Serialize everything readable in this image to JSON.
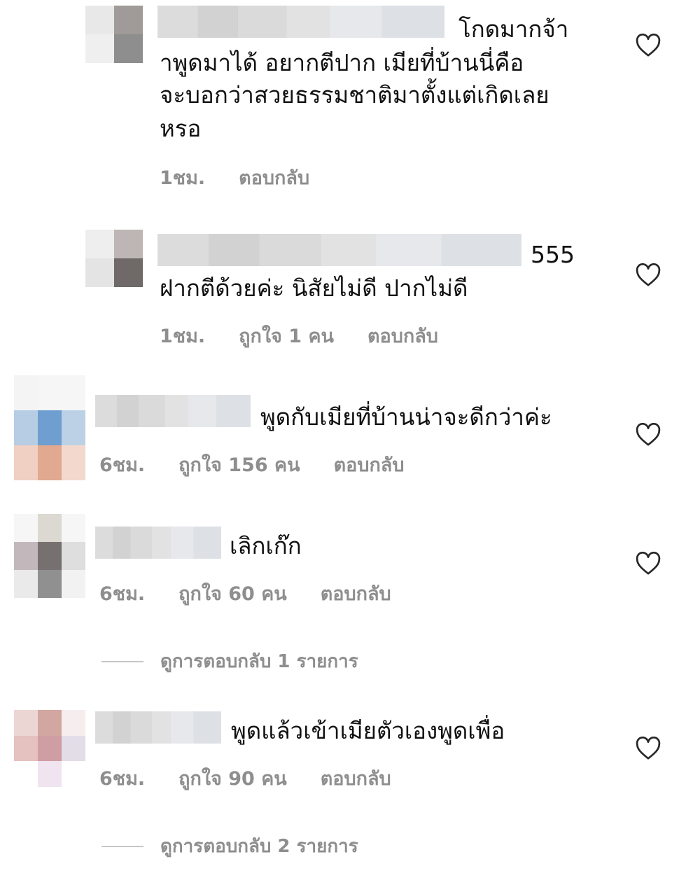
{
  "comments": [
    {
      "lines": [
        "โกดมากจ้า",
        "าพูดมาได้ อยากตีปาก  เมียที่บ้านนี่คือ",
        "จะบอกว่าสวยธรรมชาติมาตั้งแต่เกิดเลย",
        "หรอ"
      ],
      "time": "1ชม.",
      "likes": "",
      "reply": "ตอบกลับ"
    },
    {
      "lines": [
        "555",
        "ฝากตีด้วยค่ะ นิสัยไม่ดี ปากไม่ดี"
      ],
      "time": "1ชม.",
      "likes": "ถูกใจ 1 คน",
      "reply": "ตอบกลับ"
    },
    {
      "lines": [
        "พูดกับเมียที่บ้านน่าจะดีกว่าค่ะ"
      ],
      "time": "6ชม.",
      "likes": "ถูกใจ 156 คน",
      "reply": "ตอบกลับ"
    },
    {
      "lines": [
        "เลิกเก๊ก"
      ],
      "time": "6ชม.",
      "likes": "ถูกใจ 60 คน",
      "reply": "ตอบกลับ",
      "view_replies": "ดูการตอบกลับ 1 รายการ"
    },
    {
      "lines": [
        "พูดแล้วเข้าเมียตัวเองพูดเพื่อ"
      ],
      "time": "6ชม.",
      "likes": "ถูกใจ 90 คน",
      "reply": "ตอบกลับ",
      "view_replies": "ดูการตอบกลับ 2 รายการ"
    }
  ],
  "icons": {
    "like": "heart-outline-icon"
  },
  "colors": {
    "text": "#111111",
    "meta": "#8e8e8e",
    "heart": "#262626"
  }
}
